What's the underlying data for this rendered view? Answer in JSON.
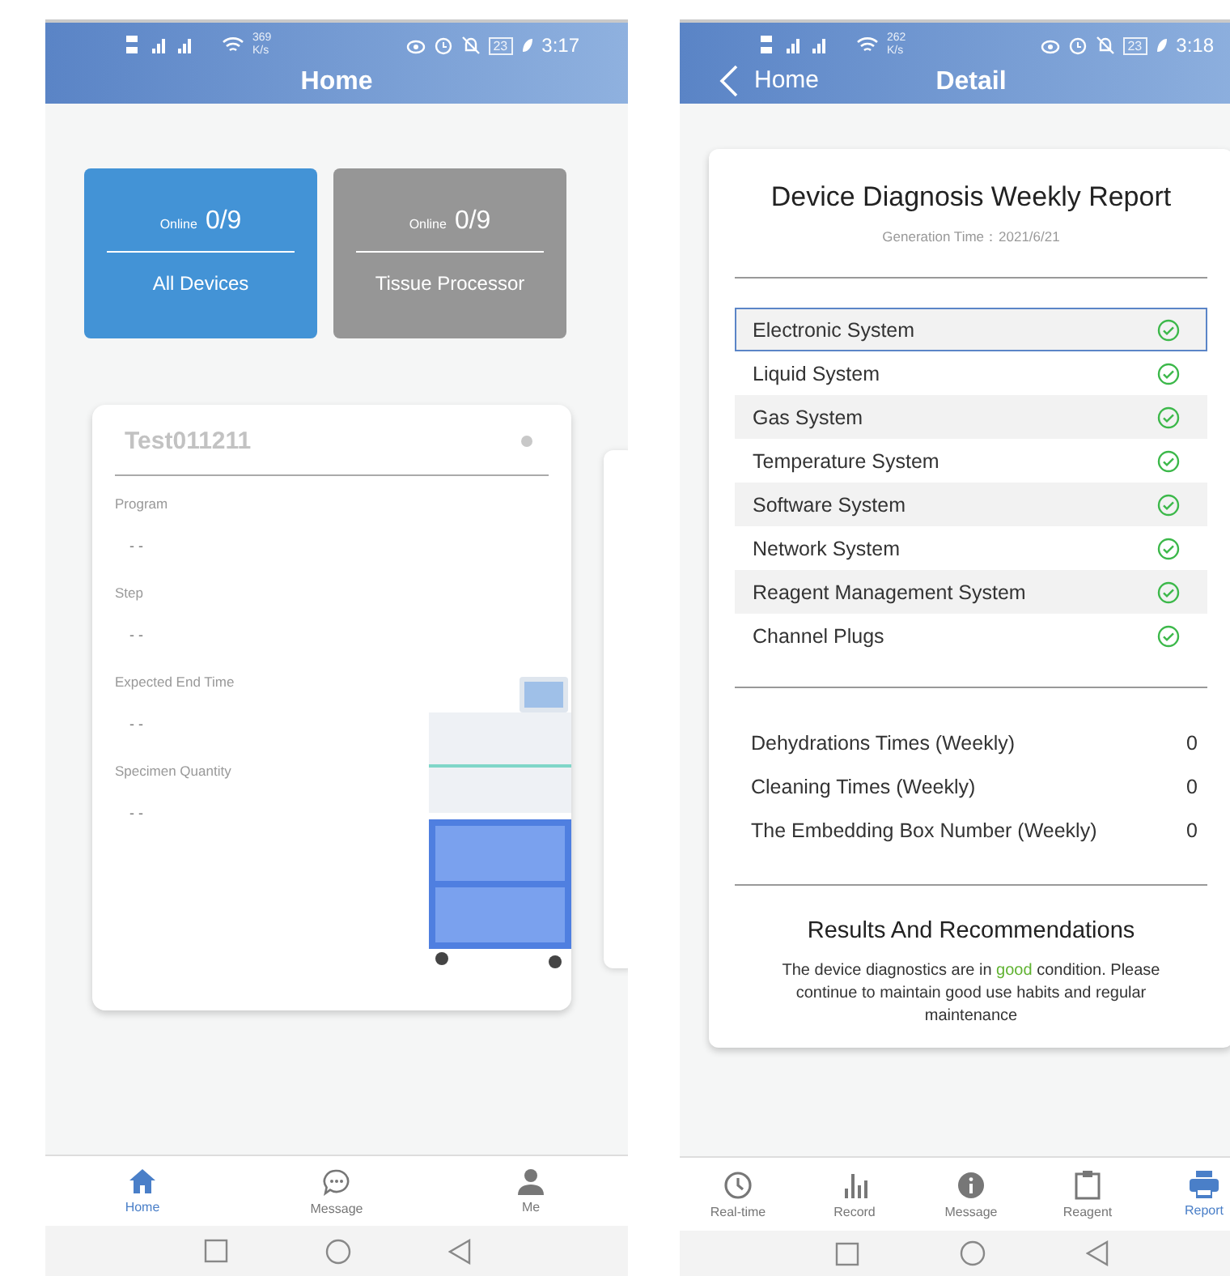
{
  "home_screen": {
    "status_bar": {
      "speed": "369",
      "speed_unit": "K/s",
      "battery": "23",
      "time": "3:17"
    },
    "title": "Home",
    "categories": [
      {
        "online_label": "Online",
        "count": "0/9",
        "label": "All Devices",
        "selected": true
      },
      {
        "online_label": "Online",
        "count": "0/9",
        "label": "Tissue Processor",
        "selected": false
      }
    ],
    "device_card": {
      "name": "Test011211",
      "fields": [
        {
          "label": "Program",
          "value": "- -"
        },
        {
          "label": "Step",
          "value": "- -"
        },
        {
          "label": "Expected End Time",
          "value": "- -"
        },
        {
          "label": "Specimen Quantity",
          "value": "- -"
        }
      ]
    },
    "tab_bar": [
      {
        "label": "Home",
        "selected": true
      },
      {
        "label": "Message",
        "selected": false
      },
      {
        "label": "Me",
        "selected": false
      }
    ]
  },
  "detail_screen": {
    "status_bar": {
      "speed": "262",
      "speed_unit": "K/s",
      "battery": "23",
      "time": "3:18"
    },
    "back_label": "Home",
    "title": "Detail",
    "report": {
      "title": "Device Diagnosis Weekly Report",
      "generation_time": "Generation Time：2021/6/21",
      "systems": [
        {
          "name": "Electronic System",
          "ok": true,
          "selected": true
        },
        {
          "name": "Liquid System",
          "ok": true,
          "selected": false
        },
        {
          "name": "Gas System",
          "ok": true,
          "selected": false
        },
        {
          "name": "Temperature System",
          "ok": true,
          "selected": false
        },
        {
          "name": "Software System",
          "ok": true,
          "selected": false
        },
        {
          "name": "Network System",
          "ok": true,
          "selected": false
        },
        {
          "name": "Reagent Management System",
          "ok": true,
          "selected": false
        },
        {
          "name": "Channel Plugs",
          "ok": true,
          "selected": false
        }
      ],
      "stats": [
        {
          "label": "Dehydrations Times (Weekly)",
          "value": "0"
        },
        {
          "label": "Cleaning Times (Weekly)",
          "value": "0"
        },
        {
          "label": "The Embedding Box Number (Weekly)",
          "value": "0"
        }
      ],
      "results_title": "Results And Recommendations",
      "results_text": {
        "before": "The device diagnostics are in ",
        "highlight": "good",
        "after": " condition. Please continue to maintain good use habits and regular maintenance"
      }
    },
    "tab_bar": [
      {
        "label": "Real-time",
        "selected": false
      },
      {
        "label": "Record",
        "selected": false
      },
      {
        "label": "Message",
        "selected": false
      },
      {
        "label": "Reagent",
        "selected": false
      },
      {
        "label": "Report",
        "selected": true
      }
    ]
  }
}
